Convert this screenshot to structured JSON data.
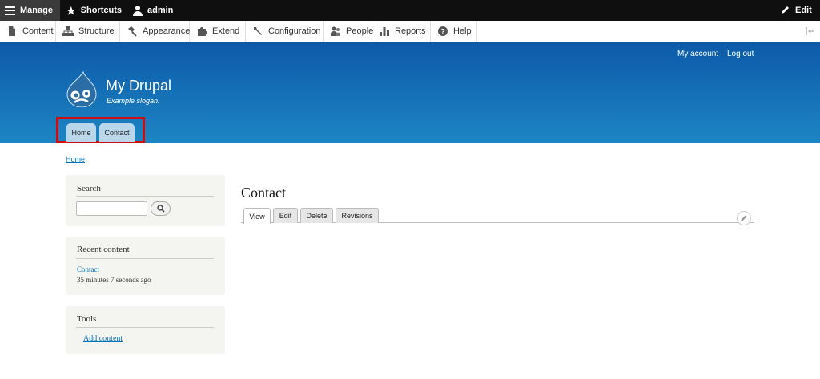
{
  "toolbar": {
    "manage": "Manage",
    "shortcuts": "Shortcuts",
    "user": "admin",
    "edit": "Edit"
  },
  "tray": {
    "items": [
      {
        "label": "Content",
        "icon": "file-icon"
      },
      {
        "label": "Structure",
        "icon": "sitemap-icon"
      },
      {
        "label": "Appearance",
        "icon": "paintbrush-icon"
      },
      {
        "label": "Extend",
        "icon": "puzzle-icon"
      },
      {
        "label": "Configuration",
        "icon": "wrench-icon"
      },
      {
        "label": "People",
        "icon": "people-icon"
      },
      {
        "label": "Reports",
        "icon": "bar-chart-icon"
      },
      {
        "label": "Help",
        "icon": "help-icon"
      }
    ]
  },
  "header": {
    "secondary_nav": [
      "My account",
      "Log out"
    ],
    "site_name": "My Drupal",
    "slogan": "Example slogan.",
    "main_nav": [
      "Home",
      "Contact"
    ]
  },
  "breadcrumb": "Home",
  "sidebar": {
    "search": {
      "title": "Search"
    },
    "recent": {
      "title": "Recent content",
      "link": "Contact",
      "time": "35 minutes 7 seconds ago"
    },
    "tools": {
      "title": "Tools",
      "link": "Add content"
    }
  },
  "main": {
    "title": "Contact",
    "tabs": [
      "View",
      "Edit",
      "Delete",
      "Revisions"
    ]
  },
  "colors": {
    "header_top": "#0d5aa8",
    "header_bottom": "#1d85c4",
    "highlight": "#cf0b0b",
    "link": "#0073ba"
  }
}
